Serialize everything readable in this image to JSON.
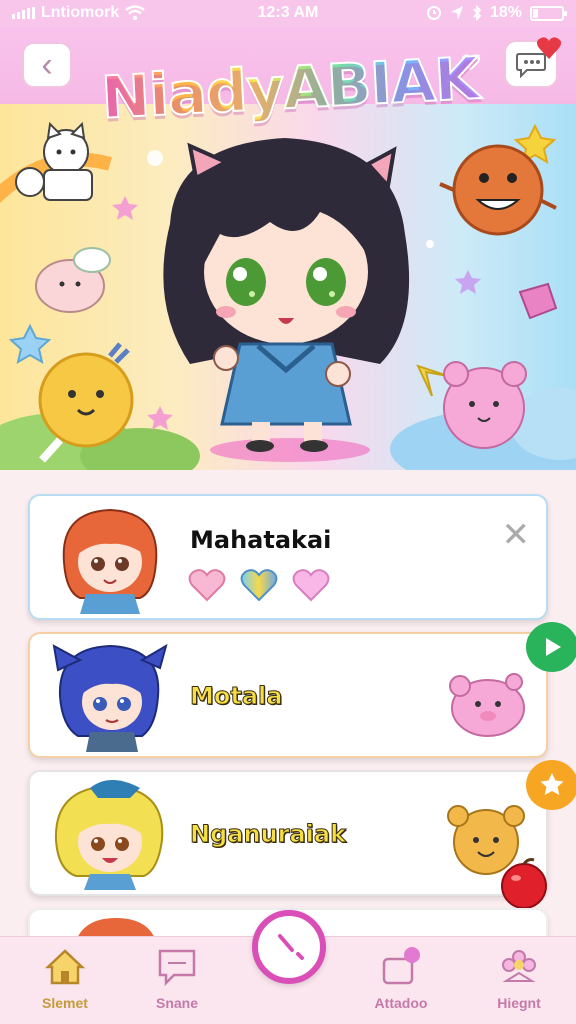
{
  "status_bar": {
    "carrier": "Lntiomork",
    "time": "12:3 AM",
    "battery": "18%",
    "battery_level": 0.18
  },
  "header": {
    "title": "NiadyABIAK",
    "back_icon": "chevron-left-icon",
    "chat_icon": "chat-bubble-icon"
  },
  "characters": [
    {
      "name": "Mahatakai",
      "avatar_color": "#e8673a",
      "hearts": [
        "heart-pink",
        "heart-rainbow",
        "heart-pink"
      ]
    },
    {
      "name": "Motala",
      "avatar_color": "#3c4fc4",
      "mascot": "pink-bear-icon"
    },
    {
      "name": "Nganuraiak",
      "avatar_color": "#f2df52",
      "mascot": "orange-bear-icon"
    }
  ],
  "nav": {
    "items": [
      {
        "label": "Slemet",
        "icon": "home-icon"
      },
      {
        "label": "Snane",
        "icon": "chat-icon"
      },
      {
        "label": "Attadoo",
        "icon": "balloon-icon"
      },
      {
        "label": "Hiegnt",
        "icon": "flower-icon"
      }
    ]
  },
  "colors": {
    "accent_pink": "#d94fb7",
    "header_bg": "#f8c3ec",
    "play_green": "#29b35b",
    "star_orange": "#f6a623"
  }
}
